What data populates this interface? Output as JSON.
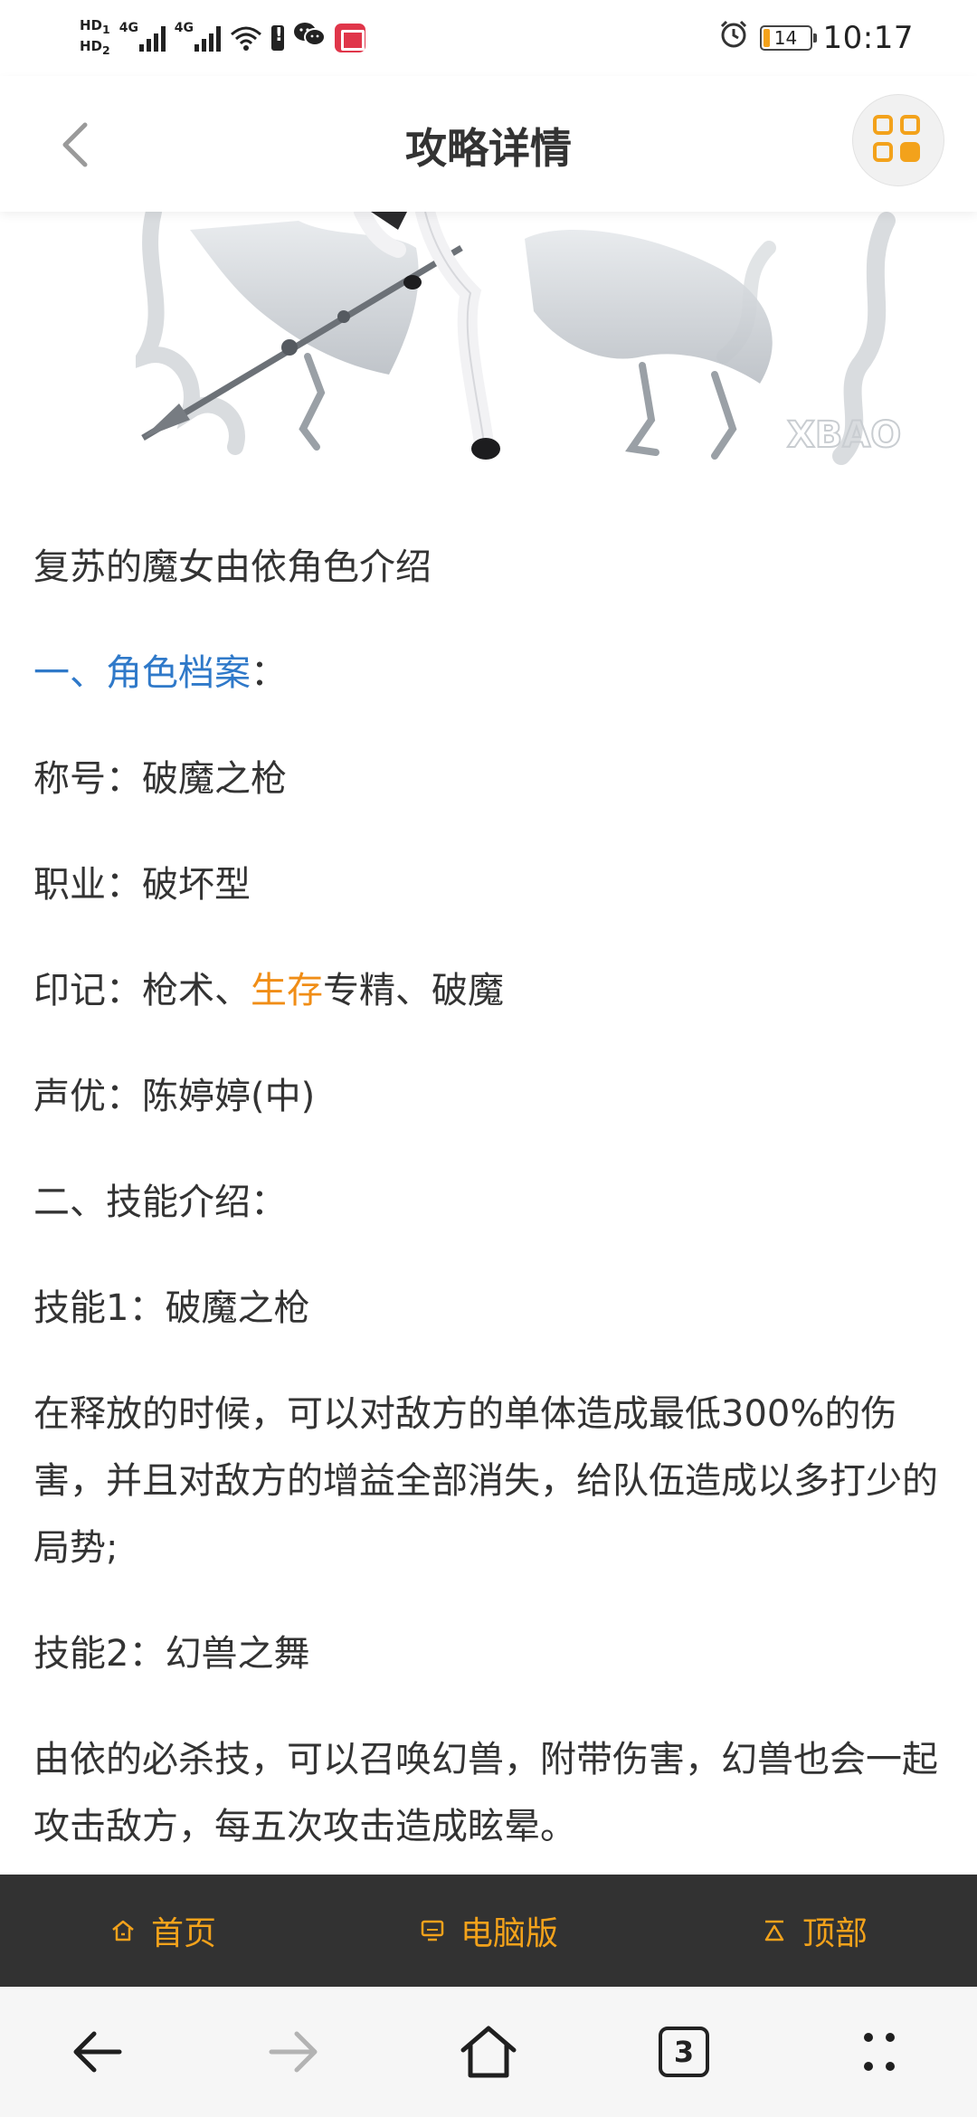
{
  "status_bar": {
    "hd1": "HD",
    "hd1_sub": "1",
    "hd2": "HD",
    "hd2_sub": "2",
    "sig1_label": "4G",
    "sig2_label": "4G",
    "battery_level": "14",
    "battery_fill_fraction": 0.14,
    "time": "10:17",
    "icons": [
      "signal-icon",
      "wifi-icon",
      "battery-alert-icon",
      "wechat-icon",
      "book-app-icon",
      "alarm-icon",
      "battery-icon"
    ]
  },
  "header": {
    "title": "攻略详情",
    "back_icon": "chevron-left-icon",
    "menu_icon": "grid-menu-icon",
    "accent": "#f3a21b"
  },
  "hero": {
    "watermark": "XBAO"
  },
  "article": {
    "intro": "复苏的魔女由依角色介绍",
    "section1_title": "一、角色档案",
    "section1_colon": "：",
    "title_label": "称号：",
    "title_value": "破魔之枪",
    "job_label": "职业：",
    "job_value": "破坏型",
    "mark_label": "印记：",
    "mark_part1": "枪术、",
    "mark_part2": "生存",
    "mark_part3": "专精、破魔",
    "cv_label": "声优：",
    "cv_value": "陈婷婷(中)",
    "section2_title": "二、技能介绍：",
    "skill1_title": "技能1：破魔之枪",
    "skill1_desc": "在释放的时候，可以对敌方的单体造成最低300%的伤害，并且对敌方的增益全部消失，给队伍造成以多打少的局势;",
    "skill2_title": "技能2：幻兽之舞",
    "skill2_desc": "由依的必杀技，可以召唤幻兽，附带伤害，幻兽也会一起攻击敌方，每五次攻击造成眩晕。",
    "colors": {
      "blue": "#2f79c9",
      "orange": "#f08d16",
      "green": "#2a9625"
    }
  },
  "bottom_nav": {
    "home_label": "首页",
    "desktop_label": "电脑版",
    "top_label": "顶部",
    "icons": [
      "home-icon",
      "monitor-icon",
      "to-top-icon"
    ]
  },
  "system_nav": {
    "tab_count": "3",
    "icons": [
      "back-arrow-icon",
      "forward-arrow-icon",
      "home-outline-icon",
      "tabs-icon",
      "more-dots-icon"
    ]
  }
}
